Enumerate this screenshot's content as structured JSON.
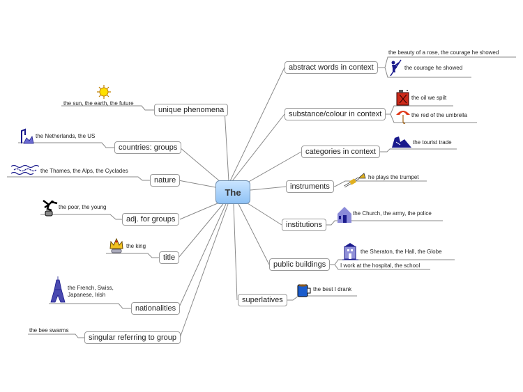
{
  "center": {
    "label": "The"
  },
  "right": [
    {
      "label": "abstract words in context",
      "subs": [
        "the beauty of a rose, the courage he showed",
        "the courage he showed"
      ],
      "icons": [
        "climber-icon"
      ]
    },
    {
      "label": "substance/colour in context",
      "subs": [
        "the oil we spilt",
        "the red of the umbrella"
      ],
      "icons": [
        "oil-can-icon",
        "umbrella-icon"
      ]
    },
    {
      "label": "categories in context",
      "subs": [
        "the tourist trade"
      ],
      "icons": [
        "tourist-icon"
      ]
    },
    {
      "label": "instruments",
      "subs": [
        "he plays the trumpet"
      ],
      "icons": [
        "trumpet-icon"
      ]
    },
    {
      "label": "institutions",
      "subs": [
        "the Church, the army, the police"
      ],
      "icons": [
        "church-icon"
      ]
    },
    {
      "label": "public buildings",
      "subs": [
        "the Sheraton, the Hall, the Globe",
        "I work at the hospital, the school"
      ],
      "icons": [
        "building-icon"
      ]
    },
    {
      "label": "superlatives",
      "subs": [
        "the best I drank"
      ],
      "icons": [
        "mug-icon"
      ]
    }
  ],
  "left": [
    {
      "label": "unique phenomena",
      "subs": [
        "the sun, the earth, the future"
      ],
      "icons": [
        "sun-icon"
      ]
    },
    {
      "label": "countries: groups",
      "subs": [
        "the Netherlands, the US"
      ],
      "icons": [
        "country-icon"
      ]
    },
    {
      "label": "nature",
      "subs": [
        "the Thames, the Alps, the Cyclades"
      ],
      "icons": [
        "waves-icon"
      ]
    },
    {
      "label": "adj. for groups",
      "subs": [
        "the poor, the young"
      ],
      "icons": [
        "jumper-icon"
      ]
    },
    {
      "label": "title",
      "subs": [
        "the king"
      ],
      "icons": [
        "crown-icon"
      ]
    },
    {
      "label": "nationalities",
      "subs": [
        "the French, Swiss,",
        "Japanese, Irish"
      ],
      "icons": [
        "eiffel-tower-icon"
      ]
    },
    {
      "label": "singular referring to group",
      "subs": [
        "the bee swarms"
      ],
      "icons": []
    }
  ],
  "colors": {
    "line": "#8a8a8a",
    "topic_border": "#9a9a9a",
    "center_fill": "#a9d3fb",
    "center_border": "#6f8fb0"
  }
}
